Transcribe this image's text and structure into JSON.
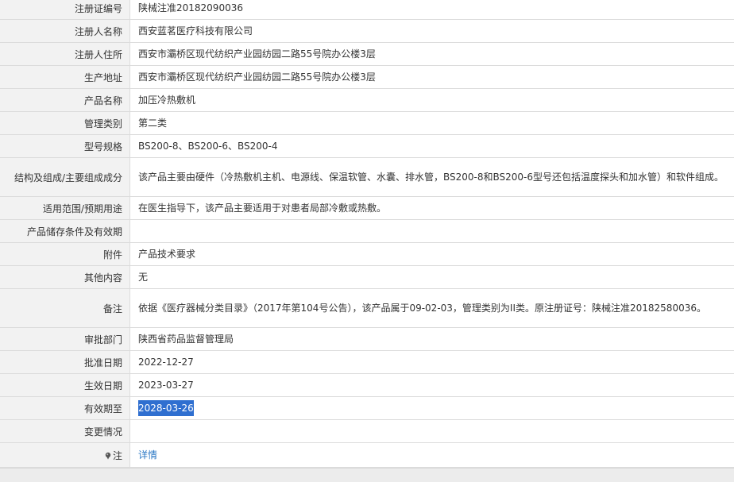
{
  "rows": [
    {
      "label": "注册证编号",
      "value": "陕械注准20182090036"
    },
    {
      "label": "注册人名称",
      "value": "西安蓝茗医疗科技有限公司"
    },
    {
      "label": "注册人住所",
      "value": "西安市灞桥区现代纺织产业园纺园二路55号院办公楼3层"
    },
    {
      "label": "生产地址",
      "value": "西安市灞桥区现代纺织产业园纺园二路55号院办公楼3层"
    },
    {
      "label": "产品名称",
      "value": "加压冷热敷机"
    },
    {
      "label": "管理类别",
      "value": "第二类"
    },
    {
      "label": "型号规格",
      "value": "BS200-8、BS200-6、BS200-4"
    },
    {
      "label": "结构及组成/主要组成成分",
      "value": "该产品主要由硬件（冷热敷机主机、电源线、保温软管、水囊、排水管，BS200-8和BS200-6型号还包括温度探头和加水管）和软件组成。"
    },
    {
      "label": "适用范围/预期用途",
      "value": "在医生指导下，该产品主要适用于对患者局部冷敷或热敷。"
    },
    {
      "label": "产品储存条件及有效期",
      "value": ""
    },
    {
      "label": "附件",
      "value": "产品技术要求"
    },
    {
      "label": "其他内容",
      "value": "无"
    },
    {
      "label": "备注",
      "value": "依据《医疗器械分类目录》（2017年第104号公告），该产品属于09-02-03，管理类别为II类。原注册证号：陕械注准20182580036。"
    },
    {
      "label": "审批部门",
      "value": "陕西省药品监督管理局"
    },
    {
      "label": "批准日期",
      "value": "2022-12-27"
    },
    {
      "label": "生效日期",
      "value": "2023-03-27"
    },
    {
      "label": "有效期至",
      "value": "2028-03-26"
    },
    {
      "label": "变更情况",
      "value": ""
    },
    {
      "label": "注",
      "value": "详情"
    }
  ],
  "note_icon": "pin-icon",
  "colors": {
    "label_bg": "#f2f2f2",
    "border": "#dcdcdc",
    "selection": "#2f6fd0",
    "link": "#2b78c5"
  }
}
